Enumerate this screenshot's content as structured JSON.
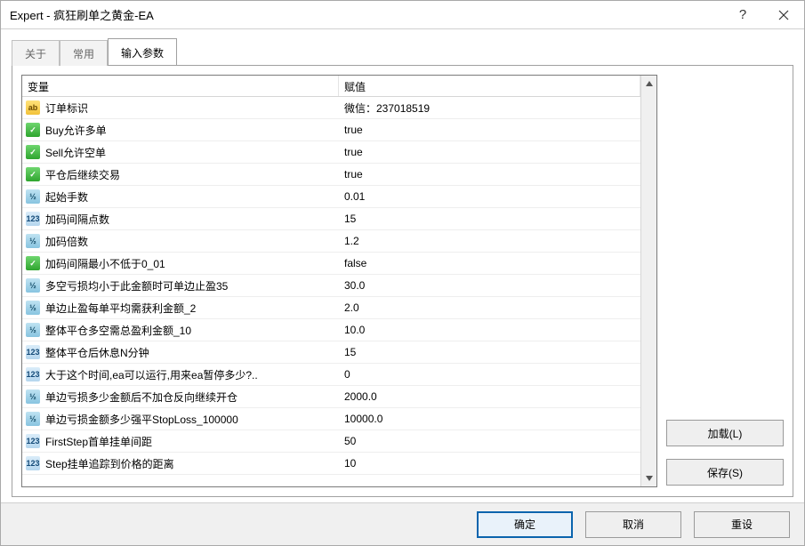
{
  "window": {
    "title": "Expert - 疯狂刷单之黄金-EA"
  },
  "tabs": {
    "about": "关于",
    "common": "常用",
    "inputs": "输入参数"
  },
  "columns": {
    "name": "变量",
    "value": "赋值"
  },
  "rows": [
    {
      "icon": "ab",
      "name": "订单标识",
      "value": "微信：237018519"
    },
    {
      "icon": "tf",
      "name": "Buy允许多单",
      "value": "true"
    },
    {
      "icon": "tf",
      "name": "Sell允许空单",
      "value": "true"
    },
    {
      "icon": "tf",
      "name": "平仓后继续交易",
      "value": "true"
    },
    {
      "icon": "v2",
      "name": "起始手数",
      "value": "0.01"
    },
    {
      "icon": "123",
      "name": "加码间隔点数",
      "value": "15"
    },
    {
      "icon": "v2",
      "name": "加码倍数",
      "value": "1.2"
    },
    {
      "icon": "tf",
      "name": "加码间隔最小不低于0_01",
      "value": "false"
    },
    {
      "icon": "v2",
      "name": "多空亏损均小于此金额时可单边止盈35",
      "value": "30.0"
    },
    {
      "icon": "v2",
      "name": "单边止盈每单平均需获利金额_2",
      "value": "2.0"
    },
    {
      "icon": "v2",
      "name": "整体平仓多空需总盈利金额_10",
      "value": "10.0"
    },
    {
      "icon": "123",
      "name": "整体平仓后休息N分钟",
      "value": "15"
    },
    {
      "icon": "123",
      "name": "大于这个时间,ea可以运行,用来ea暂停多少?..",
      "value": "0"
    },
    {
      "icon": "v2",
      "name": "单边亏损多少金额后不加仓反向继续开仓",
      "value": "2000.0"
    },
    {
      "icon": "v2",
      "name": "单边亏损金额多少强平StopLoss_100000",
      "value": "10000.0"
    },
    {
      "icon": "123",
      "name": "FirstStep首单挂单间距",
      "value": "50"
    },
    {
      "icon": "123",
      "name": "Step挂单追踪到价格的距离",
      "value": "10"
    }
  ],
  "sideButtons": {
    "load": "加载(L)",
    "save": "保存(S)"
  },
  "footerButtons": {
    "ok": "确定",
    "cancel": "取消",
    "reset": "重设"
  },
  "iconGlyph": {
    "ab": "ab",
    "tf": "✓",
    "v2": "½",
    "123": "123"
  }
}
